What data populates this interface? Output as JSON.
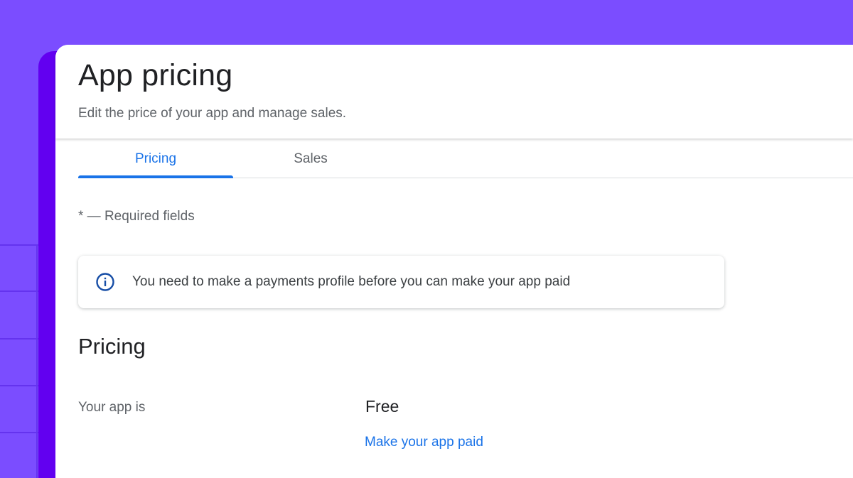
{
  "header": {
    "title": "App pricing",
    "subtitle": "Edit the price of your app and manage sales."
  },
  "tabs": [
    {
      "label": "Pricing",
      "active": true
    },
    {
      "label": "Sales",
      "active": false
    }
  ],
  "form": {
    "required_note": "* — Required fields"
  },
  "info_banner": {
    "icon": "info-icon",
    "text": "You need to make a payments profile before you can make your app paid"
  },
  "pricing_section": {
    "title": "Pricing",
    "field_label": "Your app is",
    "field_value": "Free",
    "action_link": "Make your app paid"
  },
  "colors": {
    "background": "#7b4dff",
    "side_strip": "#6200f0",
    "accent": "#1a73e8",
    "info_icon": "#174ea6"
  }
}
